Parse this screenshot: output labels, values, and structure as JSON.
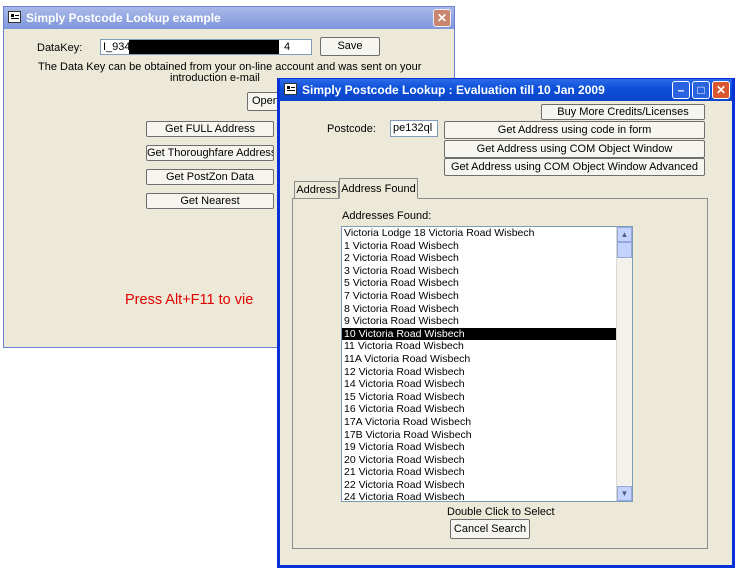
{
  "back_window": {
    "title": "Simply Postcode Lookup example",
    "datakey_label": "DataKey:",
    "datakey_value_start": "I_934",
    "datakey_value_end": "4",
    "save_label": "Save",
    "info_text_line1": "The Data Key can be obtained from your on-line account and was sent on your",
    "info_text_line2": "introduction e-mail",
    "open_label": "Open",
    "buttons": [
      {
        "label": "Get FULL Address"
      },
      {
        "label": "Get Thoroughfare Address"
      },
      {
        "label": "Get PostZon Data"
      },
      {
        "label": "Get Nearest"
      }
    ],
    "press_text": "Press Alt+F11 to vie",
    "accent_color": "#e00000"
  },
  "front_window": {
    "title": "Simply Postcode Lookup : Evaluation till 10 Jan 2009",
    "buy_label": "Buy More Credits/Licenses",
    "postcode_label": "Postcode:",
    "postcode_value": "pe132ql",
    "btn_code_in_form": "Get Address using code in form",
    "btn_com_window": "Get Address using COM Object Window",
    "btn_com_advanced": "Get Address using COM Object Window Advanced",
    "tabs": [
      {
        "label": "Address"
      },
      {
        "label": "Address Found"
      }
    ],
    "addresses_label": "Addresses Found:",
    "addresses": [
      "Victoria Lodge 18 Victoria Road Wisbech",
      "1 Victoria Road Wisbech",
      "2 Victoria Road Wisbech",
      "3 Victoria Road Wisbech",
      "5 Victoria Road Wisbech",
      "7 Victoria Road Wisbech",
      "8 Victoria Road Wisbech",
      "9 Victoria Road Wisbech",
      "10 Victoria Road Wisbech",
      "11 Victoria Road Wisbech",
      "11A Victoria Road Wisbech",
      "12 Victoria Road Wisbech",
      "14 Victoria Road Wisbech",
      "15 Victoria Road Wisbech",
      "16 Victoria Road Wisbech",
      "17A Victoria Road Wisbech",
      "17B Victoria Road Wisbech",
      "19 Victoria Road Wisbech",
      "20 Victoria Road Wisbech",
      "21 Victoria Road Wisbech",
      "22 Victoria Road Wisbech",
      "24 Victoria Road Wisbech"
    ],
    "selected_address": "10 Victoria Road Wisbech",
    "double_click_text": "Double Click to Select",
    "cancel_label": "Cancel Search"
  }
}
